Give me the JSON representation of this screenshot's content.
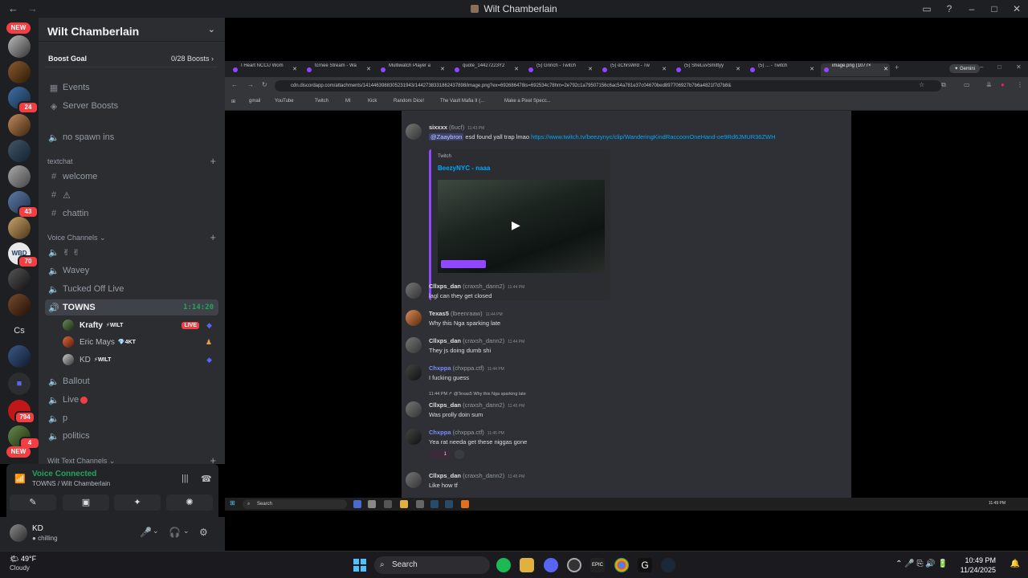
{
  "window": {
    "title": "Wilt Chamberlain"
  },
  "rail": {
    "new_top": "NEW",
    "new_bottom": "NEW",
    "badges": [
      "24",
      "43",
      "70",
      "794",
      "4"
    ],
    "server_text": "Cs"
  },
  "guild": {
    "name": "Wilt Chamberlain",
    "boost_goal": "Boost Goal",
    "boost_count": "0/28 Boosts",
    "top_items": [
      "Events",
      "Server Boosts"
    ],
    "no_spawn": "no spawn ins"
  },
  "categories": {
    "textchat": "textchat",
    "voice": "Voice Channels",
    "wilt_text": "Wilt Text Channels"
  },
  "text_channels": [
    "welcome",
    "⚠",
    "chattin"
  ],
  "voice_channels": {
    "peace": "✌ ✌",
    "wavey": "Wavey",
    "tucked": "Tucked Off Live",
    "towns": "TOWNS",
    "towns_timer": "1:14:20",
    "ballout": "Ballout",
    "live": "Live",
    "p": "p",
    "politics": "politics"
  },
  "voice_users": [
    {
      "name": "Krafty",
      "tag": "⚡WILT",
      "live": "LIVE"
    },
    {
      "name": "Eric Mays",
      "tag": "💎4KT"
    },
    {
      "name": "KD",
      "tag": "⚡WILT"
    }
  ],
  "voice_panel": {
    "status": "Voice Connected",
    "channel": "TOWNS / Wilt Chamberlain"
  },
  "user_panel": {
    "name": "KD",
    "status": "chilling"
  },
  "browser": {
    "tabs": [
      "I Heart NCCU Wom",
      "tcrnee Stream - Wa",
      "Multiwatch Player a",
      "quote_14427223Y2",
      "(5) Grinch - Twitch",
      "(5) oChrsWrd - Tw",
      "(5) SheLuvSmittyy",
      "(5) ... - Twitch",
      "image.png (1077×"
    ],
    "url": "cdn.discordapp.com/attachments/1414463988305231943/1442738331862437898/image.png?ex=692686478is=692534c78hm=2e792c1a79507156c6ac54a781e37c04670bed897706927b7b6a4821f7d7b8&",
    "bookmarks": [
      "gmail",
      "YouTube",
      "Twitch",
      "MI",
      "Kick",
      "Random Dice!",
      "The Vault Mafia II (...",
      "Make a Pixel Specc..."
    ],
    "gemini": "✦ Gemini"
  },
  "chat": {
    "m1_user": "sixxxx",
    "m1_handle": "(6ucf)",
    "m1_time": "11:43 PM",
    "m1_mention": "@Zaaybron",
    "m1_text": " esd found yall trap lmao ",
    "m1_link": "https://www.twitch.tv/beezynyc/clip/WanderingKindRaccoonOneHand-oe9Rd6JMUR36ZWH",
    "embed_provider": "Twitch",
    "embed_title": "BeezyNYC - naaa",
    "m2_user": "Cllxps_dan",
    "m2_handle": "(craxsh_dann2)",
    "m2_time": "11:44 PM",
    "m2_text": "lagl can they get closed",
    "m3_user": "Texas5",
    "m3_handle": "(lbeenraaw)",
    "m3_time": "11:44 PM",
    "m3_text": "Why this Nga sparking late",
    "m4_user": "Cllxps_dan",
    "m4_handle": "(craxsh_dann2)",
    "m4_time": "11:44 PM",
    "m4_text": "They js doing dumb shi",
    "m5_user": "Chxppa",
    "m5_handle": "(chxppa.ctf)",
    "m5_time": "11:44 PM",
    "m5_text": "I fucking guess",
    "reply_time": "11:44 PM",
    "reply_text": "@Texas5 Why this Nga sparking late",
    "m6_user": "Cllxps_dan",
    "m6_handle": "(craxsh_dann2)",
    "m6_time": "11:45 PM",
    "m6_text": "Was prolly doin sum",
    "m7_user": "Chxppa",
    "m7_handle": "(chxppa.ctf)",
    "m7_time": "11:45 PM",
    "m7_text": "Yea rat needa get these niggas gone",
    "reaction_count": "1",
    "m8_user": "Cllxps_dan",
    "m8_handle": "(craxsh_dann2)",
    "m8_time": "11:45 PM",
    "m8_text": "Like how tf"
  },
  "inner_taskbar": {
    "search": "Search",
    "clock": "11:49 PM"
  },
  "taskbar": {
    "temp": "49°F",
    "weather": "Cloudy",
    "search": "Search",
    "time": "10:49 PM",
    "date": "11/24/2025"
  }
}
